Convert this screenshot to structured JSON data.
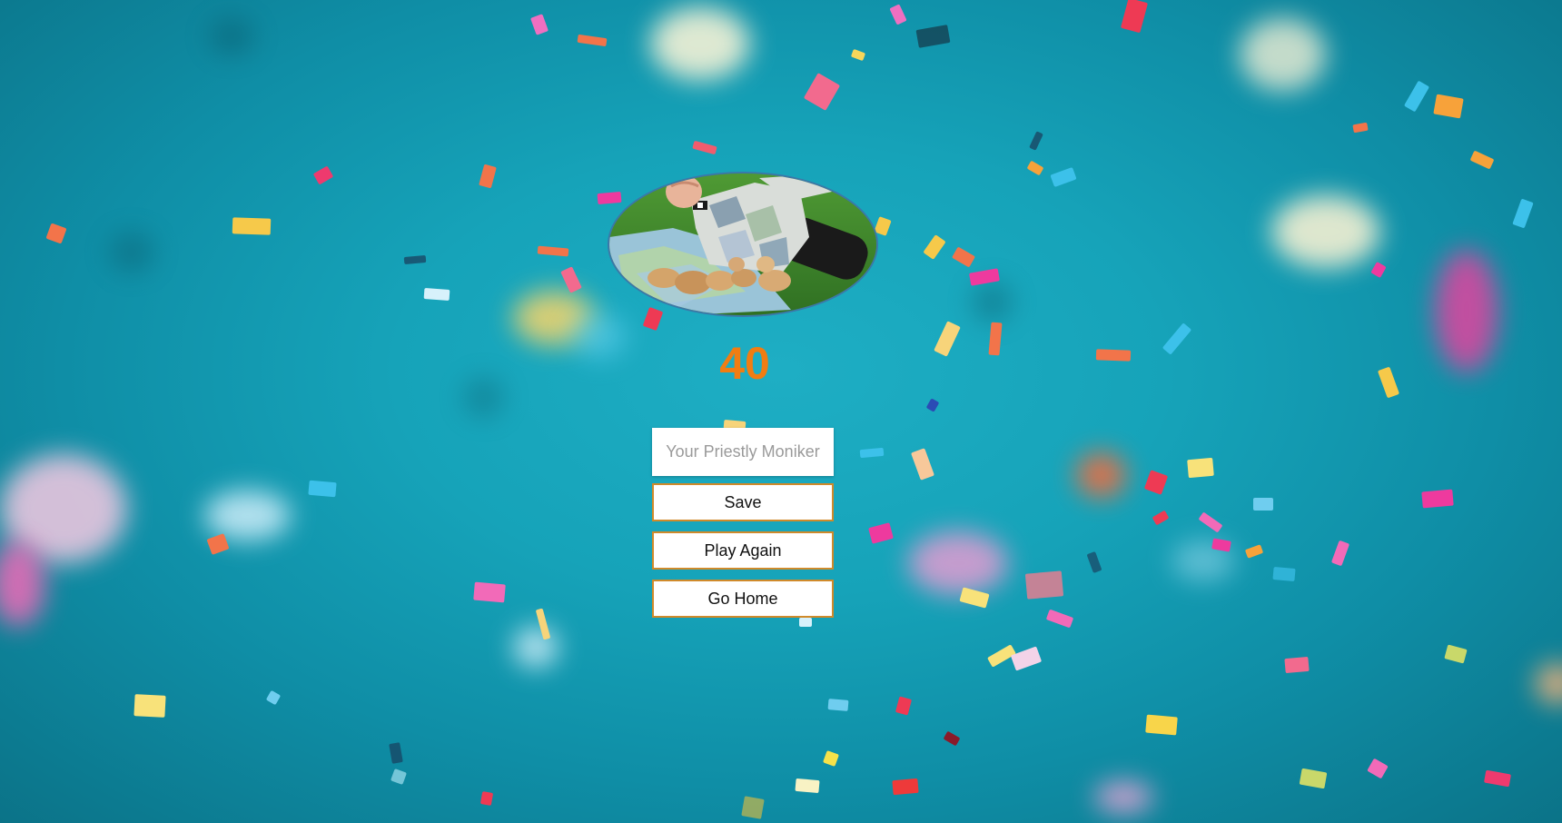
{
  "end_screen": {
    "score": "40",
    "name_input": {
      "value": "",
      "placeholder": "Your Priestly Moniker"
    },
    "buttons": {
      "save_label": "Save",
      "play_again_label": "Play Again",
      "go_home_label": "Go Home"
    },
    "avatar_icon": "priest-with-puppies-photo"
  },
  "colors": {
    "score": "#f07d12",
    "background": "#16a3b9",
    "button_border": "#d08a2a"
  }
}
